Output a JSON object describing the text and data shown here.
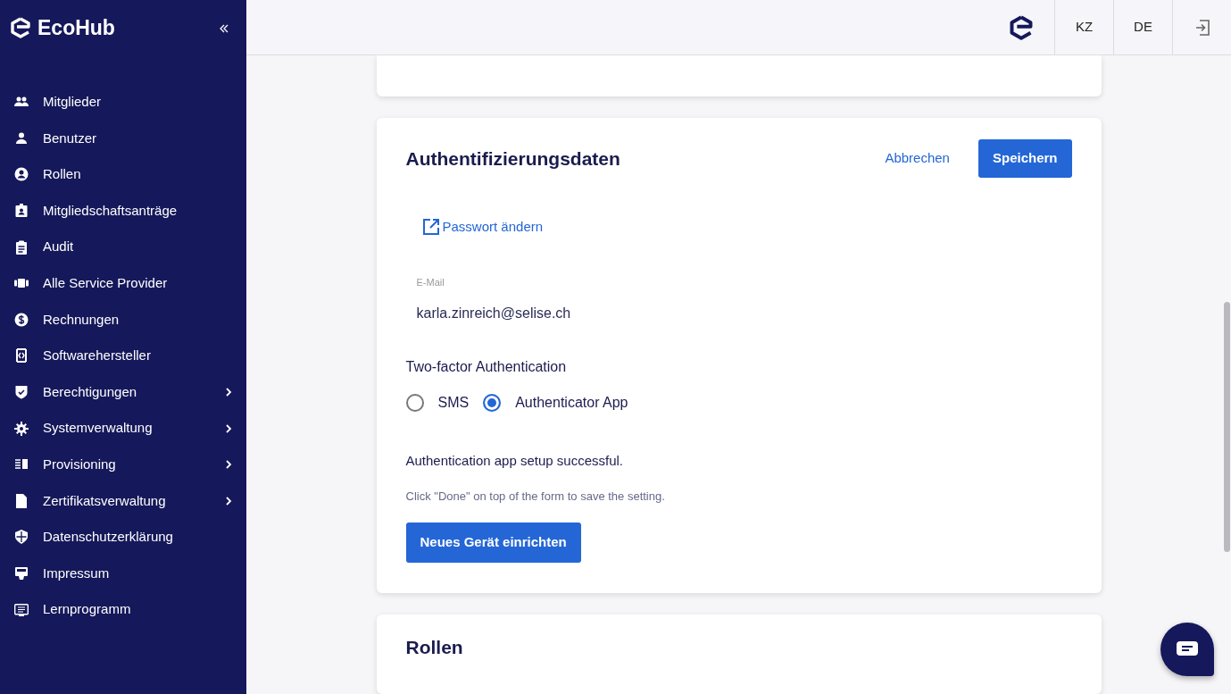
{
  "sidebar": {
    "brand": "EcoHub",
    "items": [
      {
        "label": "Mitglieder",
        "expandable": false
      },
      {
        "label": "Benutzer",
        "expandable": false
      },
      {
        "label": "Rollen",
        "expandable": false
      },
      {
        "label": "Mitgliedschaftsanträge",
        "expandable": false
      },
      {
        "label": "Audit",
        "expandable": false
      },
      {
        "label": "Alle Service Provider",
        "expandable": false
      },
      {
        "label": "Rechnungen",
        "expandable": false
      },
      {
        "label": "Softwarehersteller",
        "expandable": false
      },
      {
        "label": "Berechtigungen",
        "expandable": true
      },
      {
        "label": "Systemverwaltung",
        "expandable": true
      },
      {
        "label": "Provisioning",
        "expandable": true
      },
      {
        "label": "Zertifikatsverwaltung",
        "expandable": true
      },
      {
        "label": "Datenschutzerklärung",
        "expandable": false
      },
      {
        "label": "Impressum",
        "expandable": false
      },
      {
        "label": "Lernprogramm",
        "expandable": false
      }
    ]
  },
  "topbar": {
    "languages": [
      {
        "label": "KZ"
      },
      {
        "label": "DE"
      }
    ]
  },
  "auth_card": {
    "title": "Authentifizierungsdaten",
    "cancel": "Abbrechen",
    "save": "Speichern",
    "password_link": "Passwort ändern",
    "email": {
      "label": "E-Mail",
      "value": "karla.zinreich@selise.ch"
    },
    "two_factor": {
      "label": "Two-factor Authentication",
      "options": [
        {
          "label": "SMS",
          "selected": false
        },
        {
          "label": "Authenticator App",
          "selected": true
        }
      ]
    },
    "status": "Authentication app setup successful.",
    "hint": "Click \"Done\" on top of the form to save the setting.",
    "setup_button": "Neues Gerät einrichten"
  },
  "roles_card": {
    "title": "Rollen"
  }
}
